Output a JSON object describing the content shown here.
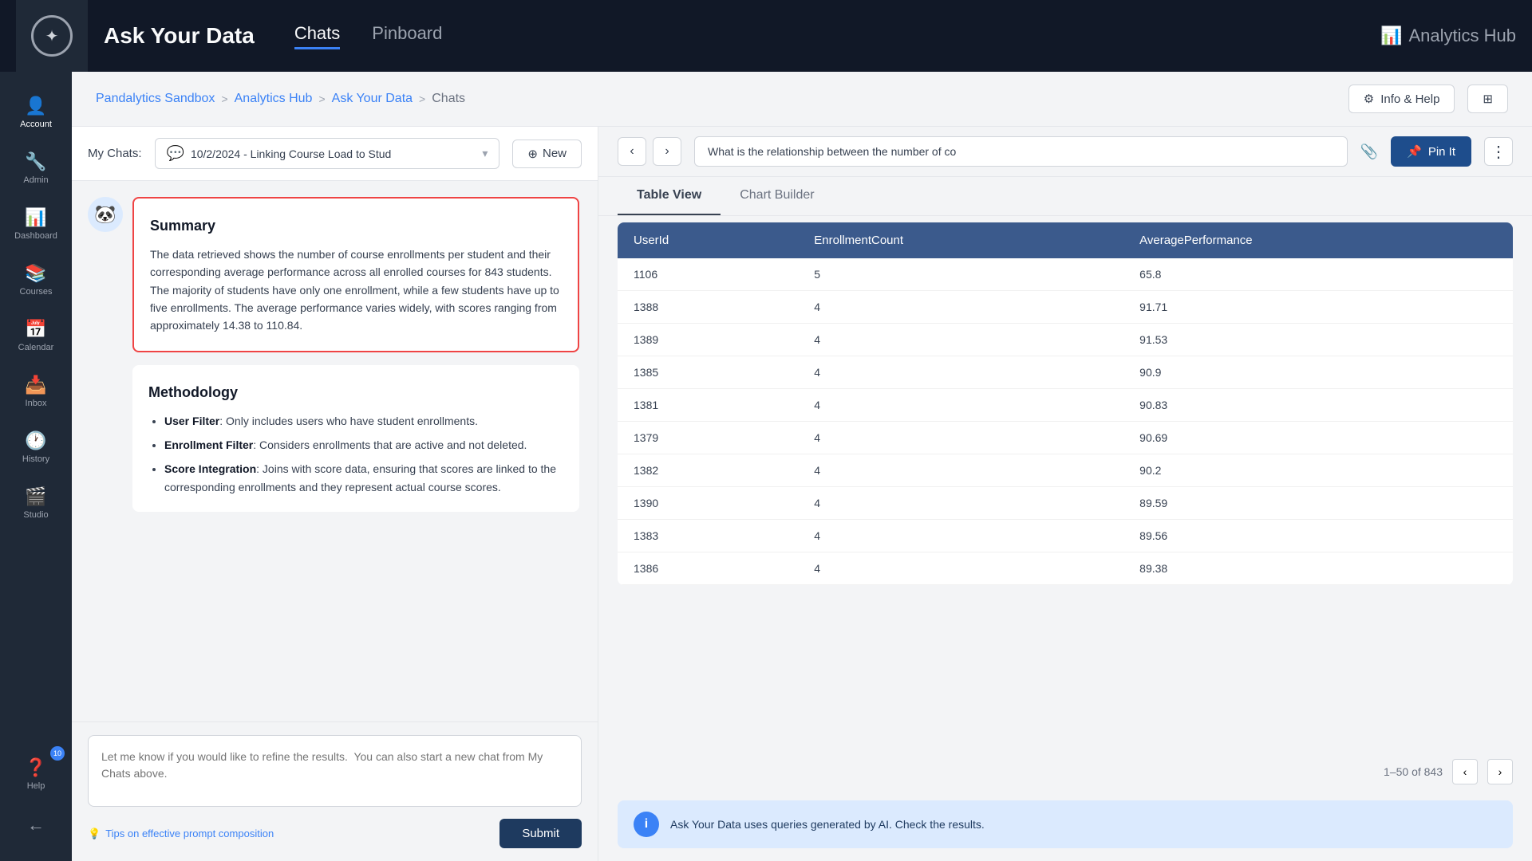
{
  "topBar": {
    "title": "Ask Your Data",
    "navItems": [
      "Chats",
      "Pinboard"
    ],
    "activeNav": "Chats",
    "analyticsHub": "Analytics Hub"
  },
  "sidebar": {
    "items": [
      {
        "id": "account",
        "label": "Account",
        "icon": "👤"
      },
      {
        "id": "admin",
        "label": "Admin",
        "icon": "🔧"
      },
      {
        "id": "dashboard",
        "label": "Dashboard",
        "icon": "📊"
      },
      {
        "id": "courses",
        "label": "Courses",
        "icon": "📚"
      },
      {
        "id": "calendar",
        "label": "Calendar",
        "icon": "📅"
      },
      {
        "id": "inbox",
        "label": "Inbox",
        "icon": "📥"
      },
      {
        "id": "history",
        "label": "History",
        "icon": "🕐"
      },
      {
        "id": "studio",
        "label": "Studio",
        "icon": "🎬"
      },
      {
        "id": "help",
        "label": "Help",
        "icon": "❓",
        "badge": "10"
      }
    ],
    "collapseIcon": "←"
  },
  "breadcrumb": {
    "items": [
      "Pandalytics Sandbox",
      "Analytics Hub",
      "Ask Your Data",
      "Chats"
    ],
    "separators": [
      ">",
      ">",
      ">"
    ]
  },
  "breadcrumbActions": {
    "infoHelp": "Info & Help"
  },
  "chatPanel": {
    "myChatsLabel": "My Chats:",
    "selectedChat": "10/2/2024 - Linking Course Load to Stud",
    "newButton": "New",
    "summary": {
      "title": "Summary",
      "text": "The data retrieved shows the number of course enrollments per student and their corresponding average performance across all enrolled courses for 843 students. The majority of students have only one enrollment, while a few students have up to five enrollments. The average performance varies widely, with scores ranging from approximately 14.38 to 110.84."
    },
    "methodology": {
      "title": "Methodology",
      "items": [
        {
          "bold": "User Filter",
          "text": ": Only includes users who have student enrollments."
        },
        {
          "bold": "Enrollment Filter",
          "text": ": Considers enrollments that are active and not deleted."
        },
        {
          "bold": "Score Integration",
          "text": ": Joins with score data, ensuring that scores are linked to the corresponding enrollments and they represent actual course scores."
        }
      ]
    },
    "inputPlaceholder": "Let me know if you would like to refine the results.  You can also start a new chat from My Chats above.",
    "tipsLink": "Tips on effective prompt composition",
    "submitButton": "Submit"
  },
  "dataPanel": {
    "queryText": "What is the relationship between the number of co",
    "pinButton": "Pin It",
    "tabs": [
      "Table View",
      "Chart Builder"
    ],
    "activeTab": "Table View",
    "table": {
      "columns": [
        "UserId",
        "EnrollmentCount",
        "AveragePerformance"
      ],
      "rows": [
        [
          "1106",
          "5",
          "65.8"
        ],
        [
          "1388",
          "4",
          "91.71"
        ],
        [
          "1389",
          "4",
          "91.53"
        ],
        [
          "1385",
          "4",
          "90.9"
        ],
        [
          "1381",
          "4",
          "90.83"
        ],
        [
          "1379",
          "4",
          "90.69"
        ],
        [
          "1382",
          "4",
          "90.2"
        ],
        [
          "1390",
          "4",
          "89.59"
        ],
        [
          "1383",
          "4",
          "89.56"
        ],
        [
          "1386",
          "4",
          "89.38"
        ]
      ]
    },
    "pagination": "1–50 of 843",
    "aiNotice": "Ask Your Data uses queries generated by AI. Check the results."
  }
}
